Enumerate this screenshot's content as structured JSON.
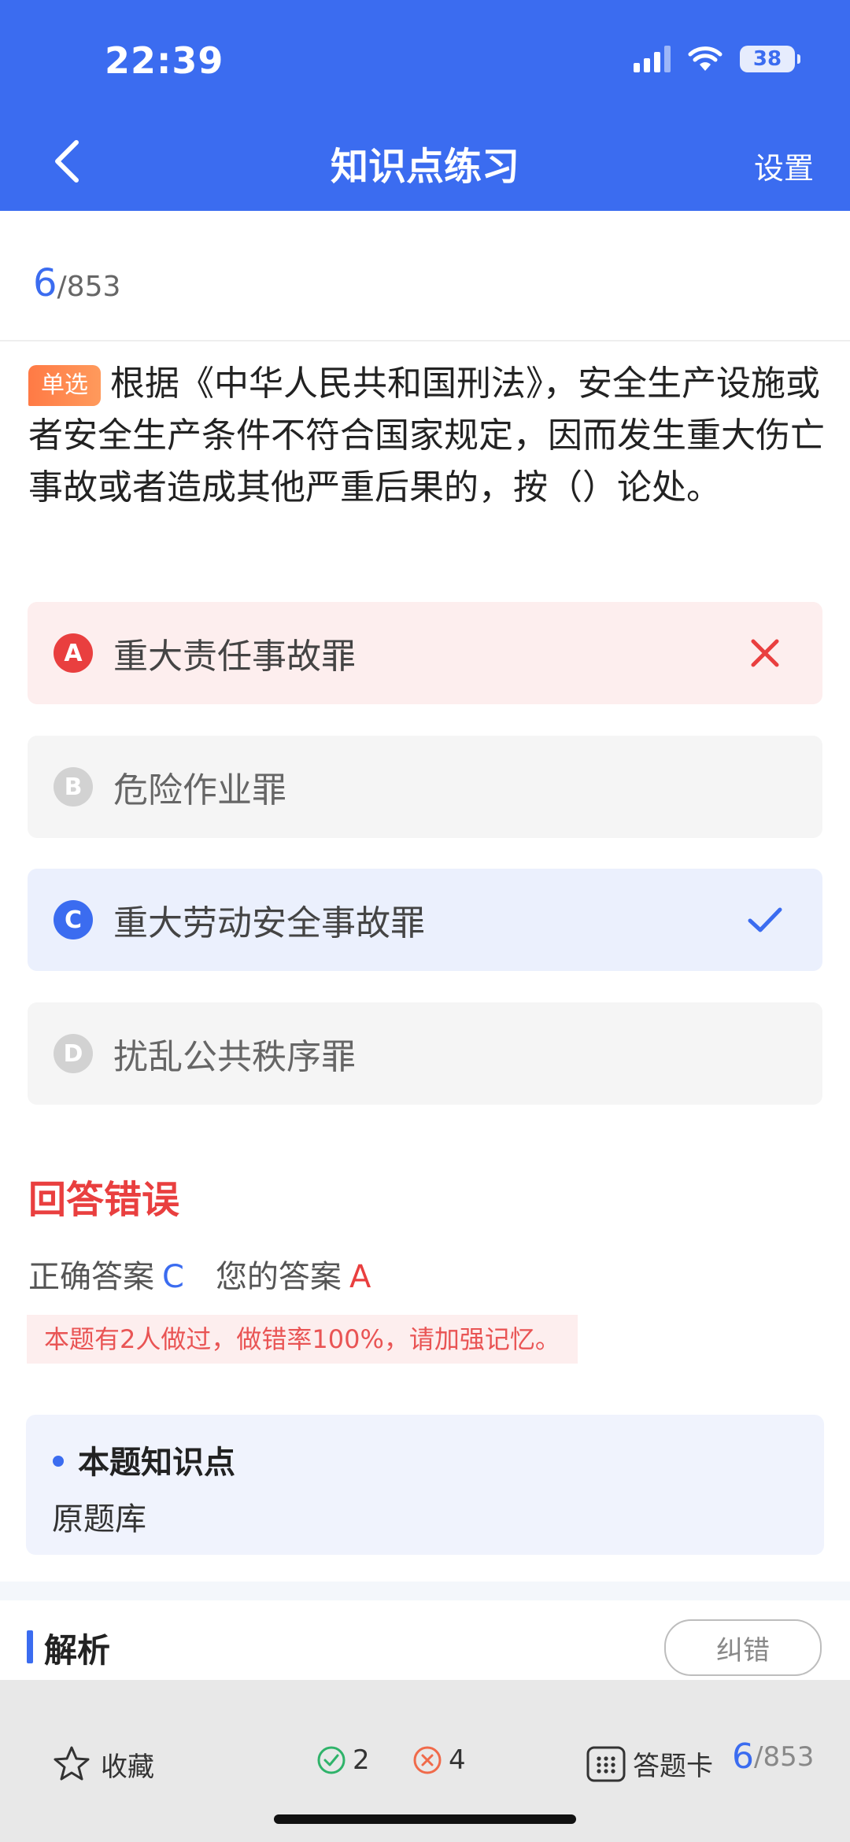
{
  "status_bar": {
    "time": "22:39",
    "battery": "38"
  },
  "nav": {
    "title": "知识点练习",
    "settings": "设置"
  },
  "progress": {
    "current": "6",
    "total": "/853"
  },
  "question": {
    "type_tag": "单选",
    "text": "根据《中华人民共和国刑法》，安全生产设施或者安全生产条件不符合国家规定，因而发生重大伤亡事故或者造成其他严重后果的，按（）论处。"
  },
  "options": [
    {
      "letter": "A",
      "text": "重大责任事故罪",
      "state": "wrong"
    },
    {
      "letter": "B",
      "text": "危险作业罪",
      "state": "normal"
    },
    {
      "letter": "C",
      "text": "重大劳动安全事故罪",
      "state": "correct"
    },
    {
      "letter": "D",
      "text": "扰乱公共秩序罪",
      "state": "normal"
    }
  ],
  "result": {
    "title": "回答错误",
    "correct_label": "正确答案",
    "correct_value": "C",
    "your_label": "您的答案",
    "your_value": "A",
    "hint": "本题有2人做过，做错率100%，请加强记忆。"
  },
  "knowledge": {
    "title": "本题知识点",
    "value": "原题库"
  },
  "analysis": {
    "title": "解析",
    "correct_button": "纠错"
  },
  "bottom": {
    "favorite": "收藏",
    "right_count": "2",
    "wrong_count": "4",
    "answer_card": "答题卡",
    "current": "6",
    "total": "/853"
  },
  "colors": {
    "primary": "#3b6cf0",
    "error": "#e93f3f",
    "tag": "#ff7a45"
  }
}
